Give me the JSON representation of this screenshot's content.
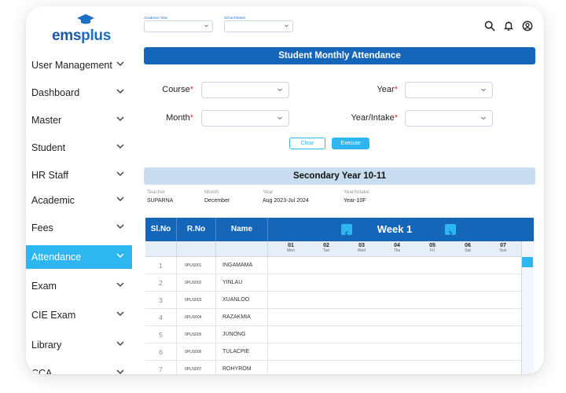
{
  "brand": {
    "name_main": "ems",
    "name_accent": "plus"
  },
  "sidebar": {
    "items": [
      {
        "label": "User Management",
        "active": false
      },
      {
        "label": "Dashboard",
        "active": false
      },
      {
        "label": "Master",
        "active": false
      },
      {
        "label": "Student",
        "active": false
      },
      {
        "label": "HR Staff",
        "active": false
      },
      {
        "label": "Academic",
        "active": false
      },
      {
        "label": "Fees",
        "active": false
      },
      {
        "label": "Attendance",
        "active": true
      },
      {
        "label": "Exam",
        "active": false
      },
      {
        "label": "CIE Exam",
        "active": false
      },
      {
        "label": "Library",
        "active": false
      },
      {
        "label": "CCA",
        "active": false
      }
    ]
  },
  "topbar": {
    "academic_year_label": "Academic Year",
    "school_name_label": "School Name",
    "icons": [
      "search-icon",
      "bell-icon",
      "user-icon"
    ]
  },
  "page": {
    "title": "Student Monthly Attendance",
    "form": {
      "course_label": "Course",
      "year_label": "Year",
      "month_label": "Month",
      "year_intake_label": "Year/Intake",
      "required_mark": "*",
      "clear_label": "Clear",
      "execute_label": "Execute"
    },
    "section_title": "Secondary Year 10-11",
    "info": [
      {
        "label": "Teacher",
        "value": "SUPARNA"
      },
      {
        "label": "Month",
        "value": "December"
      },
      {
        "label": "Year",
        "value": "Aug 2023-Jul 2024"
      },
      {
        "label": "Year/Intake",
        "value": "Year-10F"
      }
    ]
  },
  "table": {
    "columns": {
      "sl": "Sl.No",
      "rno": "R.No",
      "name": "Name"
    },
    "week_label": "Week 1",
    "days": [
      {
        "num": "01",
        "day": "Mon"
      },
      {
        "num": "02",
        "day": "Tue"
      },
      {
        "num": "03",
        "day": "Wed"
      },
      {
        "num": "04",
        "day": "Thu"
      },
      {
        "num": "05",
        "day": "Fri"
      },
      {
        "num": "06",
        "day": "Sat"
      },
      {
        "num": "07",
        "day": "Sun"
      }
    ],
    "rows": [
      {
        "sl": "1",
        "rno": "0PUS001",
        "name": "INGAMAMA"
      },
      {
        "sl": "2",
        "rno": "0PUS002",
        "name": "YINLAU"
      },
      {
        "sl": "3",
        "rno": "0PUS003",
        "name": "XUANLOO"
      },
      {
        "sl": "4",
        "rno": "0PUS004",
        "name": "RAZAKMIA"
      },
      {
        "sl": "5",
        "rno": "0PUS005",
        "name": "JUNONG"
      },
      {
        "sl": "6",
        "rno": "0PUS006",
        "name": "TULACPIE"
      },
      {
        "sl": "7",
        "rno": "0PUS007",
        "name": "ROHYROM"
      }
    ]
  },
  "colors": {
    "primary": "#1565b8",
    "accent": "#2eb6f0",
    "section": "#c8ddf0"
  }
}
